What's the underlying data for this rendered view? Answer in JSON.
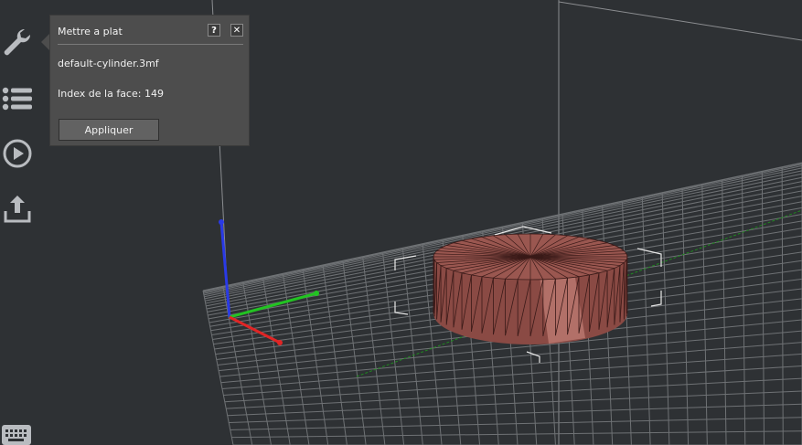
{
  "dialog": {
    "title": "Mettre a plat",
    "help_label": "?",
    "close_label": "✕",
    "file_name": "default-cylinder.3mf",
    "face_index_text": "Index de la face: 149",
    "apply_label": "Appliquer"
  },
  "sidebar": {
    "items": [
      {
        "name": "tools",
        "icon": "wrench-icon"
      },
      {
        "name": "objects-list",
        "icon": "list-icon"
      },
      {
        "name": "play",
        "icon": "play-circle-icon"
      },
      {
        "name": "export",
        "icon": "upload-icon"
      }
    ]
  },
  "colors": {
    "background": "#2e3134",
    "panel": "#4d4d4d",
    "model": "#8a4a44",
    "axis_x": "#e02020",
    "axis_y": "#20c020",
    "axis_z": "#2030e0",
    "grid": "#6f7275"
  }
}
